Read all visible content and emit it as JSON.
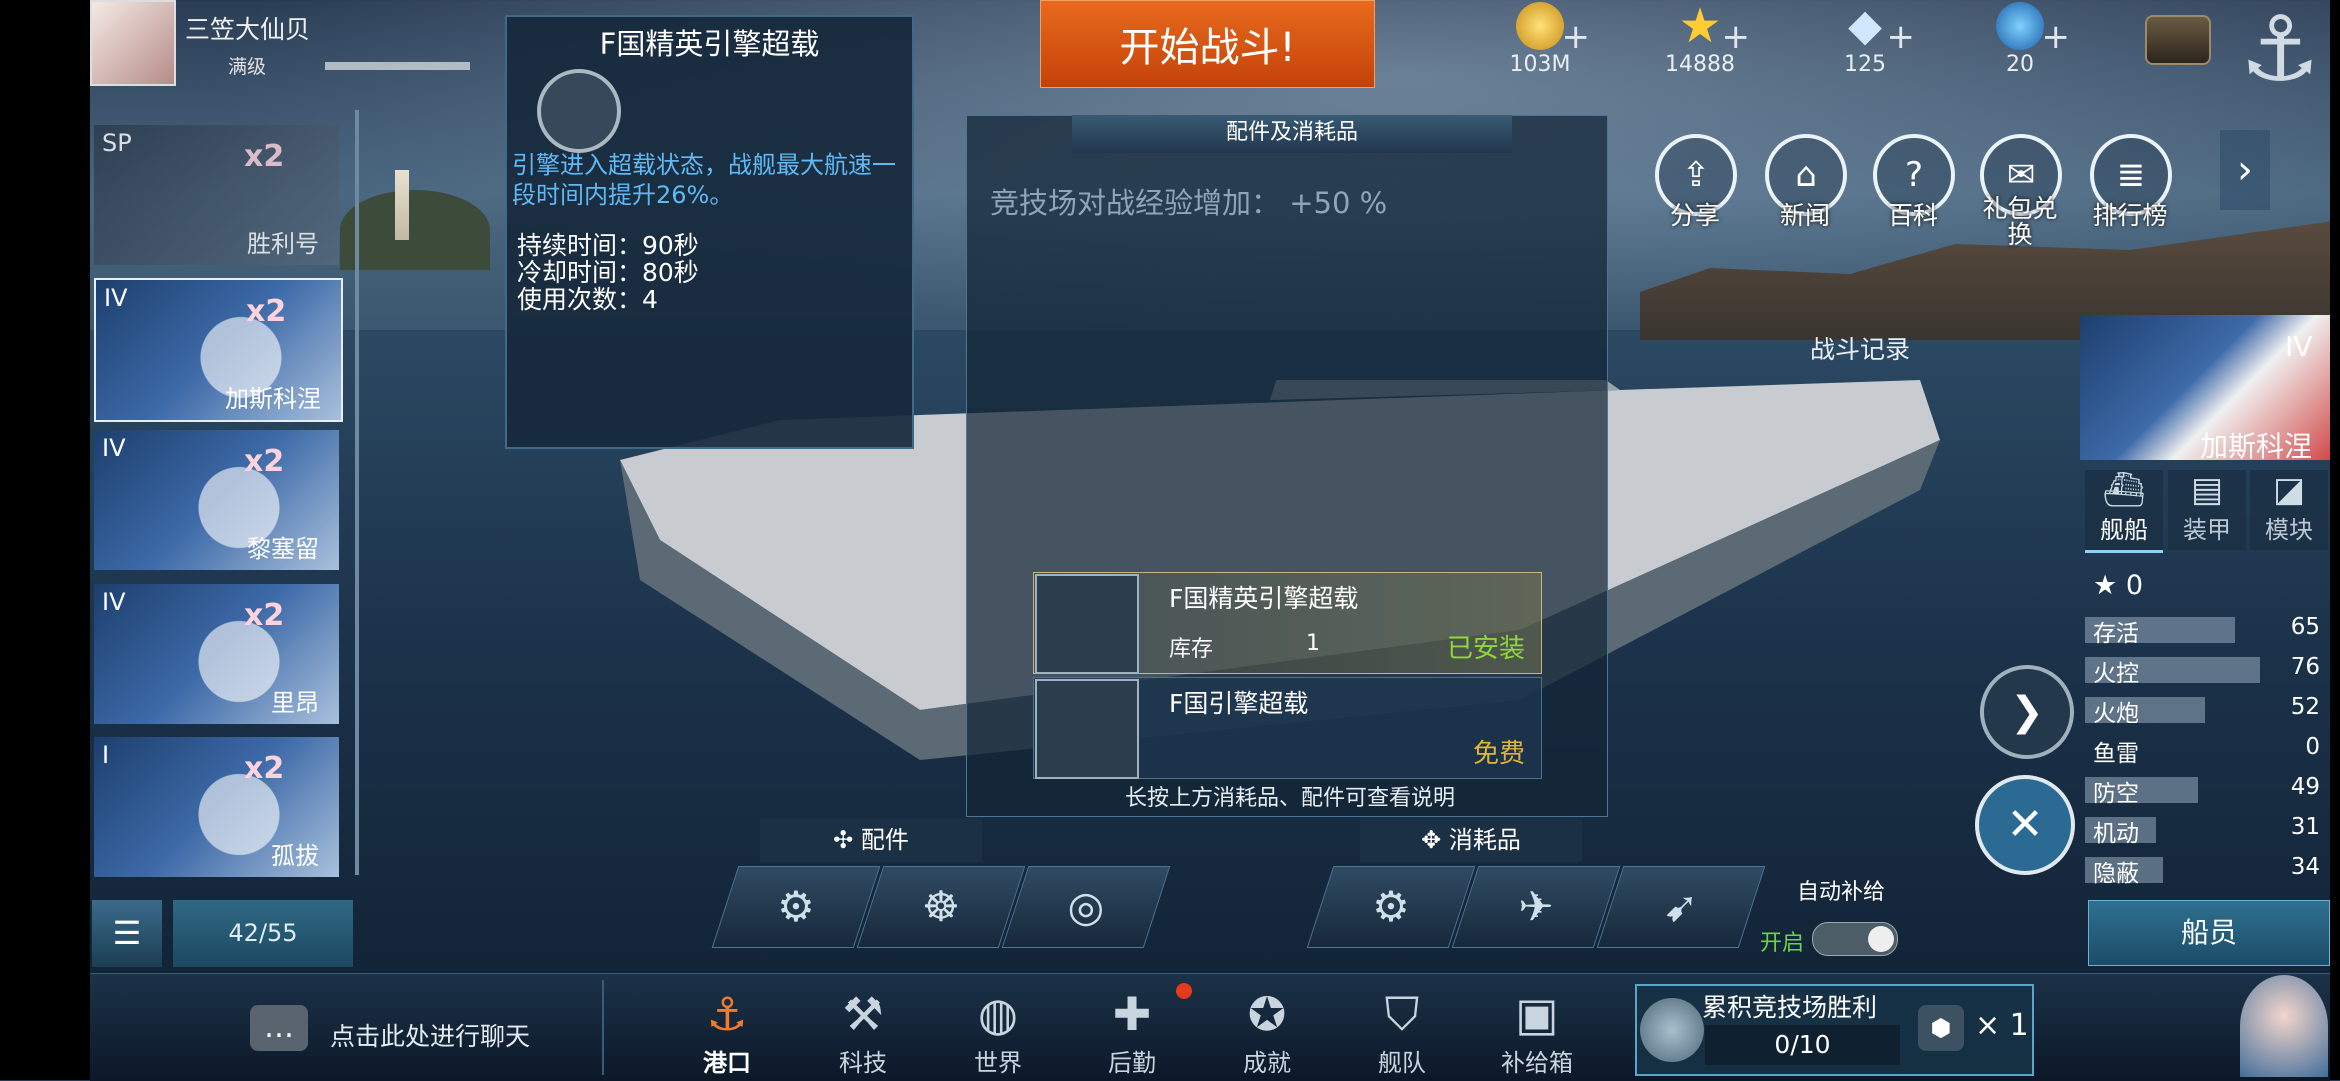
{
  "player": {
    "name": "三笠大仙贝",
    "level": "满级"
  },
  "top": {
    "start_battle": "开始战斗!",
    "resources": [
      {
        "icon": "gold-coin-icon",
        "value": "103M"
      },
      {
        "icon": "star-medal-icon",
        "value": "14888"
      },
      {
        "icon": "diamond-icon",
        "value": "125"
      },
      {
        "icon": "blue-crystal-icon",
        "value": "20"
      }
    ]
  },
  "tooltip": {
    "title": "F国精英引擎超载",
    "description": "引擎进入超载状态，战舰最大航速一段时间内提升26%。",
    "stats": [
      "持续时间：90秒",
      "冷却时间：80秒",
      "使用次数：4"
    ]
  },
  "center": {
    "header": "配件及消耗品",
    "bonus": "竞技场对战经验增加：  +50 %",
    "items": [
      {
        "name": "F国精英引擎超载",
        "stock_label": "库存",
        "stock": "1",
        "status": "已安装"
      },
      {
        "name": "F国引擎超载",
        "status": "免费"
      }
    ],
    "hint": "长按上方消耗品、配件可查看说明",
    "parts_label": "配件",
    "consumables_label": "消耗品",
    "auto_supply": "自动补给",
    "auto_supply_state": "开启"
  },
  "ship_list": {
    "cards": [
      {
        "tier": "SP",
        "mult": "x2",
        "name": "胜利号"
      },
      {
        "tier": "IV",
        "mult": "x2",
        "name": "加斯科涅"
      },
      {
        "tier": "IV",
        "mult": "x2",
        "name": "黎塞留"
      },
      {
        "tier": "IV",
        "mult": "x2",
        "name": "里昂"
      },
      {
        "tier": "I",
        "mult": "x2",
        "name": "孤拔"
      }
    ],
    "count": "42/55"
  },
  "right_menu": {
    "buttons": [
      "分享",
      "新闻",
      "百科",
      "礼包兑换",
      "排行榜"
    ],
    "battle_record": "战斗记录"
  },
  "right_panel": {
    "ship_tier": "IV",
    "ship_name": "加斯科涅",
    "tabs": [
      "舰船",
      "装甲",
      "模块"
    ],
    "stars": "0",
    "stats": [
      {
        "label": "存活",
        "value": 65
      },
      {
        "label": "火控",
        "value": 76
      },
      {
        "label": "火炮",
        "value": 52
      },
      {
        "label": "鱼雷",
        "value": 0
      },
      {
        "label": "防空",
        "value": 49
      },
      {
        "label": "机动",
        "value": 31
      },
      {
        "label": "隐蔽",
        "value": 34
      }
    ],
    "crew": "船员"
  },
  "bottom": {
    "chat": "点击此处进行聊天",
    "nav": [
      "港口",
      "科技",
      "世界",
      "后勤",
      "成就",
      "舰队",
      "补给箱"
    ],
    "arena_title": "累积竞技场胜利",
    "arena_progress": "0/10",
    "arena_reward_count": "× 1"
  }
}
